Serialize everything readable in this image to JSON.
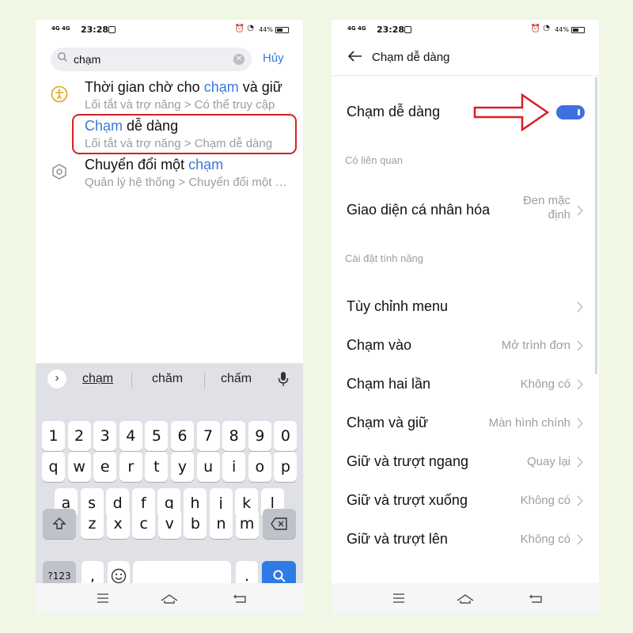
{
  "left": {
    "status": {
      "network": "4G 4G",
      "time": "23:28",
      "battery": "44%"
    },
    "search": {
      "value": "chạm",
      "cancel": "Hủy"
    },
    "results": [
      {
        "title_before": "Thời gian chờ cho ",
        "title_hl": "chạm",
        "title_after": " và giữ",
        "path": "Lối tắt và trợ năng > Có thể truy cập",
        "icon": "accessibility-icon"
      },
      {
        "title_before": "",
        "title_hl": "Chạm",
        "title_after": " dễ dàng",
        "path": "Lối tắt và trợ năng > Chạm dễ dàng",
        "icon": "none"
      },
      {
        "title_before": "Chuyển đổi một ",
        "title_hl": "chạm",
        "title_after": "",
        "path": "Quản lý hệ thống > Chuyển đổi một chạm",
        "icon": "hexagon-settings-icon"
      }
    ],
    "keyboard": {
      "suggestions": [
        "chạm",
        "chăm",
        "chấm"
      ],
      "number_row": [
        "1",
        "2",
        "3",
        "4",
        "5",
        "6",
        "7",
        "8",
        "9",
        "0"
      ],
      "row1": [
        "q",
        "w",
        "e",
        "r",
        "t",
        "y",
        "u",
        "i",
        "o",
        "p"
      ],
      "row2": [
        "a",
        "s",
        "d",
        "f",
        "g",
        "h",
        "j",
        "k",
        "l"
      ],
      "row3": [
        "z",
        "x",
        "c",
        "v",
        "b",
        "n",
        "m"
      ],
      "symbols": "?123",
      "comma": ",",
      "period": "."
    }
  },
  "right": {
    "status": {
      "network": "4G 4G",
      "time": "23:28",
      "battery": "44%"
    },
    "header_title": "Chạm dễ dàng",
    "toggle_label": "Chạm dễ dàng",
    "toggle_on": true,
    "section_related": "Có liên quan",
    "theme": {
      "label": "Giao diện cá nhân hóa",
      "value_line1": "Đen mặc",
      "value_line2": "định"
    },
    "section_features": "Cài đặt tính năng",
    "rows": [
      {
        "label": "Tùy chỉnh menu",
        "value": ""
      },
      {
        "label": "Chạm vào",
        "value": "Mở trình đơn"
      },
      {
        "label": "Chạm hai lần",
        "value": "Không có"
      },
      {
        "label": "Chạm và giữ",
        "value": "Màn hình chính"
      },
      {
        "label": "Giữ và trượt ngang",
        "value": "Quay lại"
      },
      {
        "label": "Giữ và trượt xuống",
        "value": "Không có"
      },
      {
        "label": "Giữ và trượt lên",
        "value": "Không có"
      }
    ]
  },
  "colors": {
    "accent": "#3b78d8",
    "highlight_box": "#d91e27",
    "toggle": "#3f6fe0",
    "background": "#f0f7e4"
  }
}
